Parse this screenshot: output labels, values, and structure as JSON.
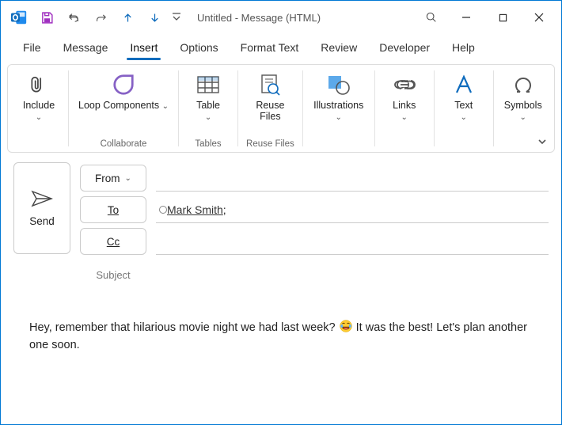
{
  "window": {
    "title": "Untitled  -  Message (HTML)"
  },
  "menubar": [
    "File",
    "Message",
    "Insert",
    "Options",
    "Format Text",
    "Review",
    "Developer",
    "Help"
  ],
  "activeMenu": "Insert",
  "ribbon": {
    "include": {
      "label": "Include"
    },
    "loop": {
      "label": "Loop Components",
      "group": "Collaborate"
    },
    "table": {
      "label": "Table",
      "group": "Tables"
    },
    "reuse": {
      "label": "Reuse Files",
      "group": "Reuse Files"
    },
    "illustrations": {
      "label": "Illustrations"
    },
    "links": {
      "label": "Links"
    },
    "text": {
      "label": "Text"
    },
    "symbols": {
      "label": "Symbols"
    }
  },
  "compose": {
    "send": "Send",
    "from": "From",
    "to": "To",
    "cc": "Cc",
    "subject_label": "Subject",
    "subject_value": "",
    "recipients_to": "Mark Smith",
    "recipient_separator": ";"
  },
  "body": {
    "part1": "Hey, remember that hilarious movie night we had last week? ",
    "part2": " It was the best! Let's plan another one soon."
  }
}
